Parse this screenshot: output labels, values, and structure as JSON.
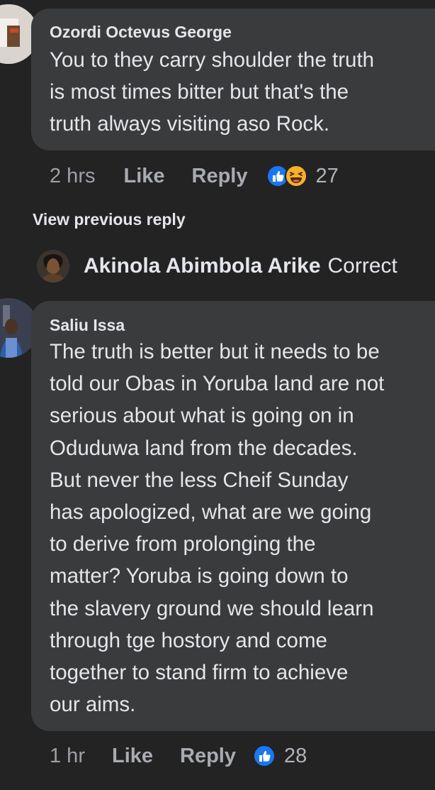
{
  "comments": [
    {
      "author": "Ozordi Octevus George",
      "text": "You to they carry shoulder the truth\nis most times bitter but that's the\ntruth always visiting aso Rock.",
      "time": "2 hrs",
      "like_label": "Like",
      "reply_label": "Reply",
      "reactions": [
        "like-reaction-icon",
        "haha-reaction-icon"
      ],
      "reaction_count": "27"
    },
    {
      "author": "Saliu Issa",
      "text": "The truth is better but it needs to be\ntold our Obas in Yoruba land are not\nserious about what is going on in\nOduduwa land from the decades.\n   But never the less Cheif Sunday\nhas apologized, what are we going\nto derive from prolonging the\nmatter? Yoruba is going down to\nthe slavery ground we should learn\nthrough tge hostory and come\ntogether to stand firm to achieve\nour aims.",
      "time": "1 hr",
      "like_label": "Like",
      "reply_label": "Reply",
      "reactions": [
        "like-reaction-icon"
      ],
      "reaction_count": "28"
    }
  ],
  "view_previous_reply": "View previous reply",
  "collapsed_reply": {
    "author": "Akinola Abimbola Arike",
    "text": "Correct"
  },
  "colors": {
    "background": "#232324",
    "bubble": "#3a3b3c",
    "like_blue": "#1877f2",
    "haha_yellow": "#f7b125"
  }
}
